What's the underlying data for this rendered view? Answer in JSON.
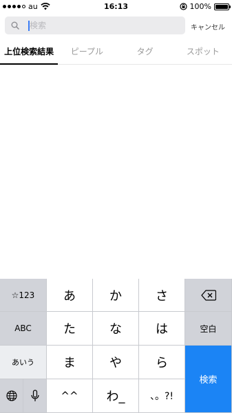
{
  "status_bar": {
    "carrier": "au",
    "time": "16:13",
    "battery": "100%"
  },
  "search": {
    "placeholder": "検索",
    "value": "",
    "cancel_label": "キャンセル"
  },
  "tabs": [
    {
      "label": "上位検索結果",
      "active": true
    },
    {
      "label": "ピープル",
      "active": false
    },
    {
      "label": "タグ",
      "active": false
    },
    {
      "label": "スポット",
      "active": false
    }
  ],
  "keyboard": {
    "mode_key": "☆123",
    "abc_key": "ABC",
    "kana_key": "あいう",
    "space_key": "空白",
    "search_key": "検索",
    "rows": [
      [
        "あ",
        "か",
        "さ"
      ],
      [
        "た",
        "な",
        "は"
      ],
      [
        "ま",
        "や",
        "ら"
      ],
      [
        "^^",
        "わ_",
        "、。?!"
      ]
    ]
  }
}
